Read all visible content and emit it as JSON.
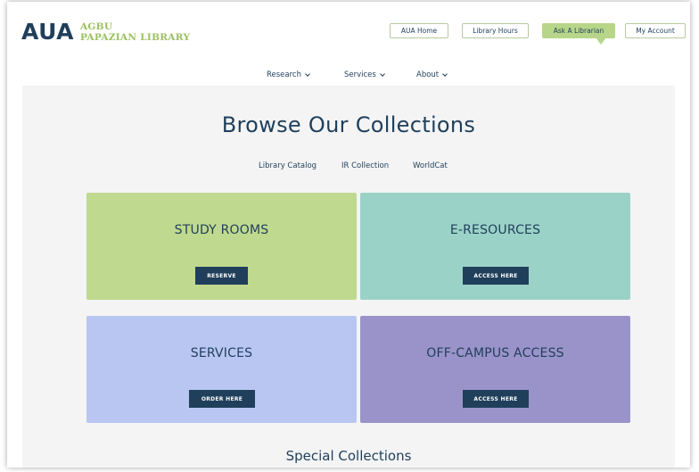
{
  "header": {
    "logo": {
      "aua": "AUA",
      "line1": "AGBU",
      "line2": "PAPAZIAN LIBRARY"
    },
    "buttons": [
      {
        "label": "AUA Home"
      },
      {
        "label": "Library Hours"
      },
      {
        "label": "Ask A Librarian"
      },
      {
        "label": "My Account"
      }
    ]
  },
  "nav": {
    "items": [
      {
        "label": "Research"
      },
      {
        "label": "Services"
      },
      {
        "label": "About"
      }
    ]
  },
  "main": {
    "title": "Browse Our Collections",
    "collection_links": [
      {
        "label": "Library Catalog"
      },
      {
        "label": "IR Collection"
      },
      {
        "label": "WorldCat"
      }
    ],
    "cards": [
      {
        "title": "STUDY ROOMS",
        "button": "RESERVE",
        "color": "#bfd98f"
      },
      {
        "title": "E-RESOURCES",
        "button": "ACCESS HERE",
        "color": "#9bd2c7"
      },
      {
        "title": "SERVICES",
        "button": "ORDER HERE",
        "color": "#b9c6f2"
      },
      {
        "title": "OFF-CAMPUS ACCESS",
        "button": "ACCESS HERE",
        "color": "#9a93c9"
      }
    ],
    "special_heading": "Special Collections"
  },
  "colors": {
    "brand_navy": "#1f3f5b",
    "brand_green": "#9bc060",
    "ask_button": "#b8d68a"
  }
}
